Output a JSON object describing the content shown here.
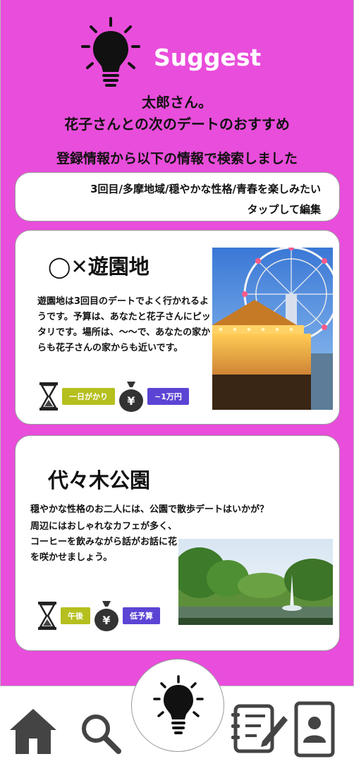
{
  "header": {
    "title": "Suggest",
    "icon": "lightbulb-icon"
  },
  "greeting": {
    "line1": "太郎さん。",
    "line2": "花子さんとの次のデートのおすすめ"
  },
  "search_caption": "登録情報から以下の情報で検索しました",
  "conditions": {
    "text": "3回目/多摩地域/穏やかな性格/青春を楽しみたい",
    "edit_label": "タップして編集"
  },
  "suggestions": [
    {
      "title": "◯✕遊園地",
      "description": "遊園地は3回目のデートでよく行かれるようです。予算は、あなたと花子さんにピッタリです。場所は、〜〜で、あなたの家からも花子さんの家からも近いです。",
      "time_badge": "一日がかり",
      "budget_badge": "~1万円",
      "image": "amusement-park-ferris-wheel-photo"
    },
    {
      "title": "代々木公園",
      "description_top": "穏やかな性格のお二人には、公園で散歩デートはいかが？",
      "description_rest": "周辺にはおしゃれなカフェが多く、コーヒーを飲みながら話がお話に花を咲かせましょう。",
      "time_badge": "午後",
      "budget_badge": "低予算",
      "image": "park-fountain-photo"
    }
  ],
  "colors": {
    "background": "#e94ddb",
    "time_badge": "#b5bf1e",
    "budget_badge": "#5b44d4",
    "title_text": "#ffffff"
  },
  "nav": {
    "items": [
      "home-icon",
      "search-icon",
      "lightbulb-icon",
      "notes-edit-icon",
      "profile-icon"
    ],
    "active": "lightbulb-icon"
  }
}
